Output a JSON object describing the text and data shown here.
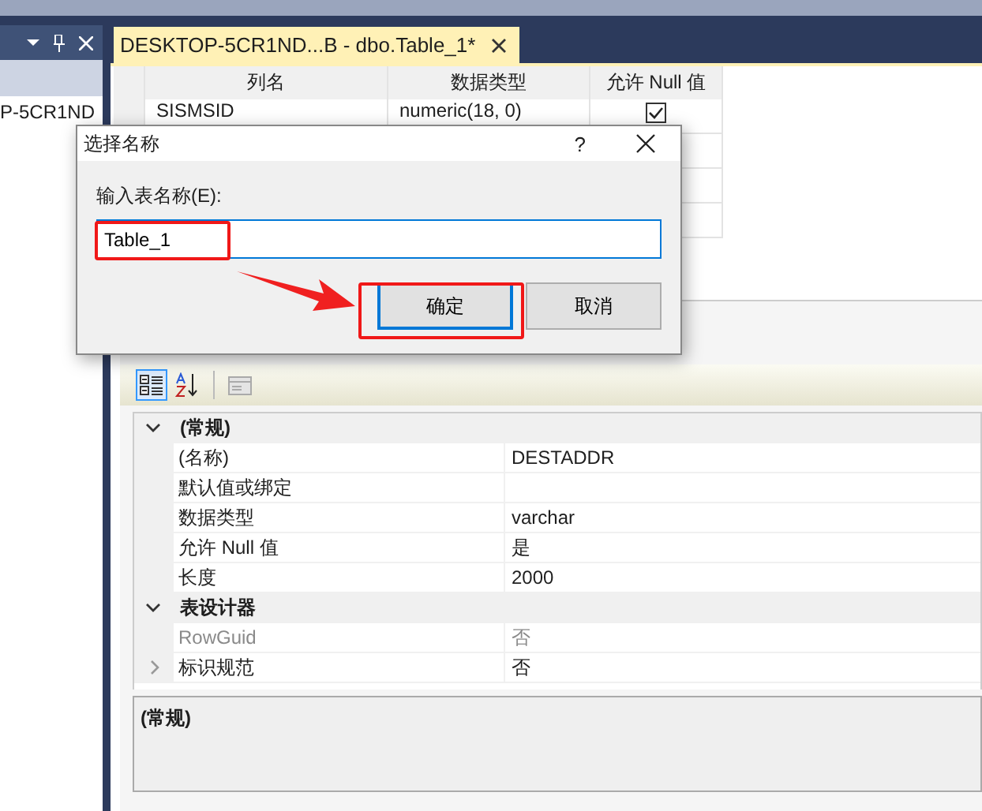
{
  "left_panel": {
    "tree_item": "P-5CR1ND"
  },
  "tabs": [
    {
      "label": "DESKTOP-5CR1ND...B - dbo.Table_1*",
      "selected": true
    }
  ],
  "columns_grid": {
    "columns": [
      "列名",
      "数据类型",
      "允许 Null 值"
    ],
    "rows": [
      {
        "name": "SISMSID",
        "type": "numeric(18, 0)",
        "allow_null": true
      }
    ]
  },
  "properties": {
    "toolbar": [
      {
        "kind": "categorized",
        "selected": true
      },
      {
        "kind": "alphabetical",
        "selected": false
      },
      {
        "kind": "pages",
        "disabled": true
      }
    ],
    "sections": [
      {
        "title": "(常规)",
        "expanded": true,
        "items": [
          {
            "name": "(名称)",
            "value": "DESTADDR",
            "disabled": false
          },
          {
            "name": "默认值或绑定",
            "disabled": false
          },
          {
            "name": "数据类型",
            "value": "varchar",
            "disabled": false
          },
          {
            "name": "允许 Null 值",
            "value": "是",
            "disabled": false
          },
          {
            "name": "长度",
            "value": "2000",
            "disabled": false
          }
        ]
      },
      {
        "title": "表设计器",
        "expanded": true,
        "items": [
          {
            "name": "RowGuid",
            "value": "否",
            "disabled": true
          },
          {
            "name": "标识规范",
            "value": "否",
            "disabled": false,
            "expandable": true
          }
        ]
      }
    ],
    "description": {
      "title": "(常规)"
    }
  },
  "dialog": {
    "title": "选择名称",
    "help": "?",
    "label": "输入表名称(E):",
    "value": "Table_1",
    "buttons": [
      {
        "label": "确定",
        "default": true
      },
      {
        "label": "取消",
        "default": false
      }
    ]
  }
}
